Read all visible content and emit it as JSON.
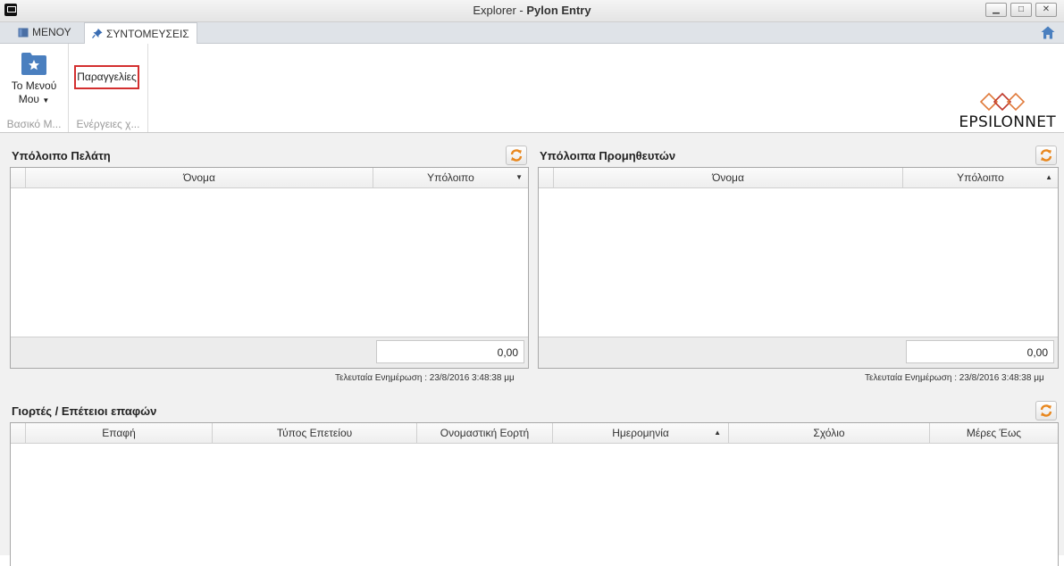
{
  "window": {
    "title_prefix": "Explorer - ",
    "title_app": "Pylon Entry",
    "minimize": "▁",
    "maximize": "□",
    "close": "✕"
  },
  "tabs": {
    "menu": "ΜΕΝΟΥ",
    "shortcuts": "ΣΥΝΤΟΜΕΥΣΕΙΣ"
  },
  "ribbon": {
    "my_menu_label_line1": "Το Μενού",
    "my_menu_label_line2": "Μου",
    "group1_label": "Βασικό Μ...",
    "orders_button": "Παραγγελίες",
    "group2_label": "Ενέργειες χ..."
  },
  "logo": {
    "text": "EPSILONNET"
  },
  "customer_balance": {
    "title": "Υπόλοιπο Πελάτη",
    "col_name": "Όνομα",
    "col_balance": "Υπόλοιπο",
    "sort_arrow": "▼",
    "total": "0,00",
    "updated": "Τελευταία Ενημέρωση : 23/8/2016   3:48:38 μμ"
  },
  "supplier_balance": {
    "title": "Υπόλοιπα Προμηθευτών",
    "col_name": "Όνομα",
    "col_balance": "Υπόλοιπο",
    "sort_arrow": "▲",
    "total": "0,00",
    "updated": "Τελευταία Ενημέρωση : 23/8/2016   3:48:38 μμ"
  },
  "holidays": {
    "title": "Γιορτές / Επέτειοι επαφών",
    "columns": [
      "Επαφή",
      "Τύπος Επετείου",
      "Ονομαστική Εορτή",
      "Ημερομηνία",
      "Σχόλιο",
      "Μέρες Έως"
    ],
    "sort_arrow": "▲"
  },
  "colors": {
    "accent_red": "#d32f2f",
    "refresh_orange": "#e8871e",
    "folder_blue": "#4a7fbf"
  }
}
